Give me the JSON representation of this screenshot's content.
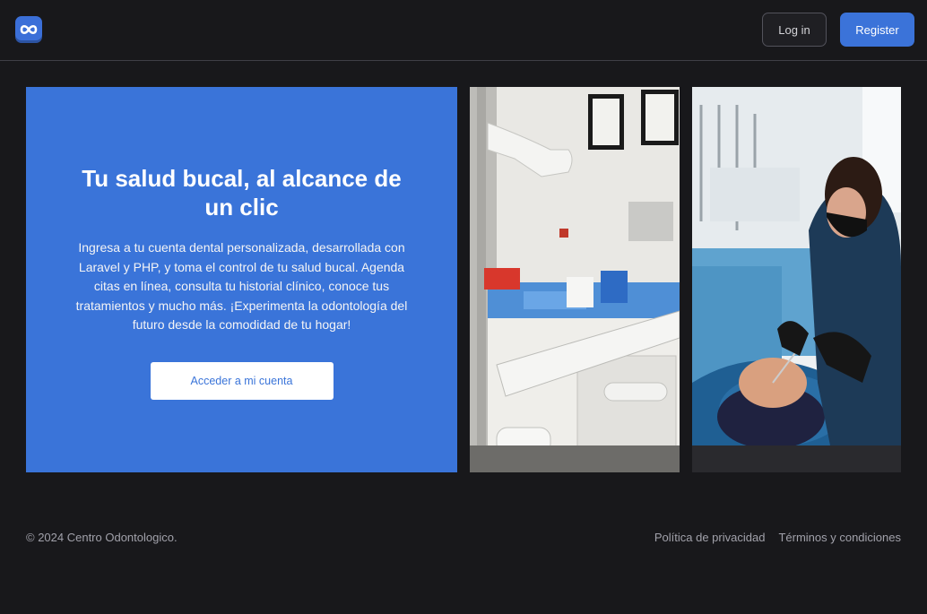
{
  "header": {
    "logo_icon": "infinity-logo-icon",
    "login_label": "Log in",
    "register_label": "Register"
  },
  "hero": {
    "title": "Tu salud bucal, al alcance de un clic",
    "description": "Ingresa a tu cuenta dental personalizada, desarrollada con Laravel y PHP, y toma el control de tu salud bucal. Agenda citas en línea, consulta tu historial clínico, conoce tus tratamientos y mucho más. ¡Experimenta la odontología del futuro desde la comodidad de tu hogar!",
    "button_label": "Acceder a mi cuenta",
    "background_color": "#3a74d9"
  },
  "footer": {
    "copyright": "© 2024 Centro Odontologico.",
    "privacy_link": "Política de privacidad",
    "terms_link": "Términos y condiciones"
  }
}
